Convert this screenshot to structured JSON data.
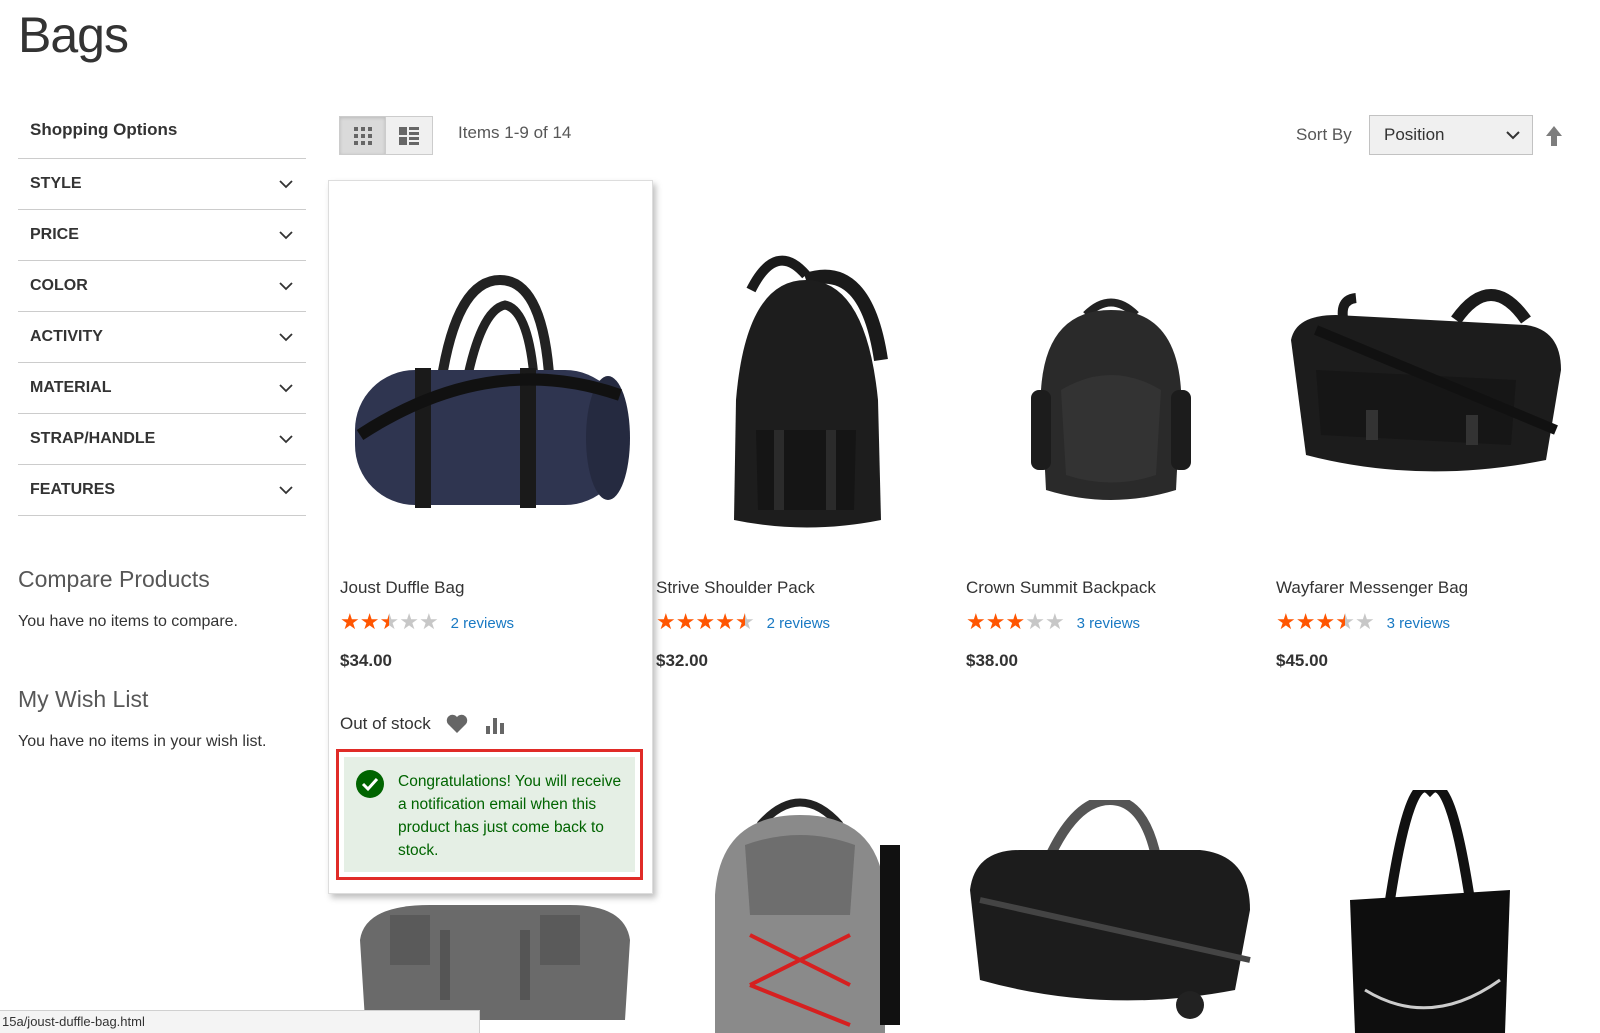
{
  "page": {
    "title": "Bags"
  },
  "sidebar": {
    "heading": "Shopping Options",
    "filters": [
      "STYLE",
      "PRICE",
      "COLOR",
      "ACTIVITY",
      "MATERIAL",
      "STRAP/HANDLE",
      "FEATURES"
    ],
    "compare": {
      "title": "Compare Products",
      "text": "You have no items to compare."
    },
    "wishlist": {
      "title": "My Wish List",
      "text": "You have no items in your wish list."
    }
  },
  "toolbar": {
    "items_count": "Items 1-9 of 14",
    "sort_label": "Sort By",
    "sort_value": "Position"
  },
  "products": [
    {
      "name": "Joust Duffle Bag",
      "rating": 2.5,
      "reviews": "2 reviews",
      "price": "$34.00",
      "color": "#2f3550"
    },
    {
      "name": "Strive Shoulder Pack",
      "rating": 4.5,
      "reviews": "2 reviews",
      "price": "$32.00",
      "color": "#1d1d1d"
    },
    {
      "name": "Crown Summit Backpack",
      "rating": 3,
      "reviews": "3 reviews",
      "price": "$38.00",
      "color": "#2a2a2a"
    },
    {
      "name": "Wayfarer Messenger Bag",
      "rating": 3.5,
      "reviews": "3 reviews",
      "price": "$45.00",
      "color": "#1c1c1c"
    }
  ],
  "hover_product": {
    "stock_status": "Out of stock",
    "notification": "Congratulations! You will receive a notification email when this product has just come back to stock."
  },
  "status_bar": {
    "url": "15a/joust-duffle-bag.html"
  },
  "colors": {
    "star": "#ff5501",
    "star_empty": "#c7c7c7",
    "link": "#1979c3",
    "success_bg": "#e5efe5",
    "success_text": "#006400",
    "highlight": "#e02b27"
  }
}
